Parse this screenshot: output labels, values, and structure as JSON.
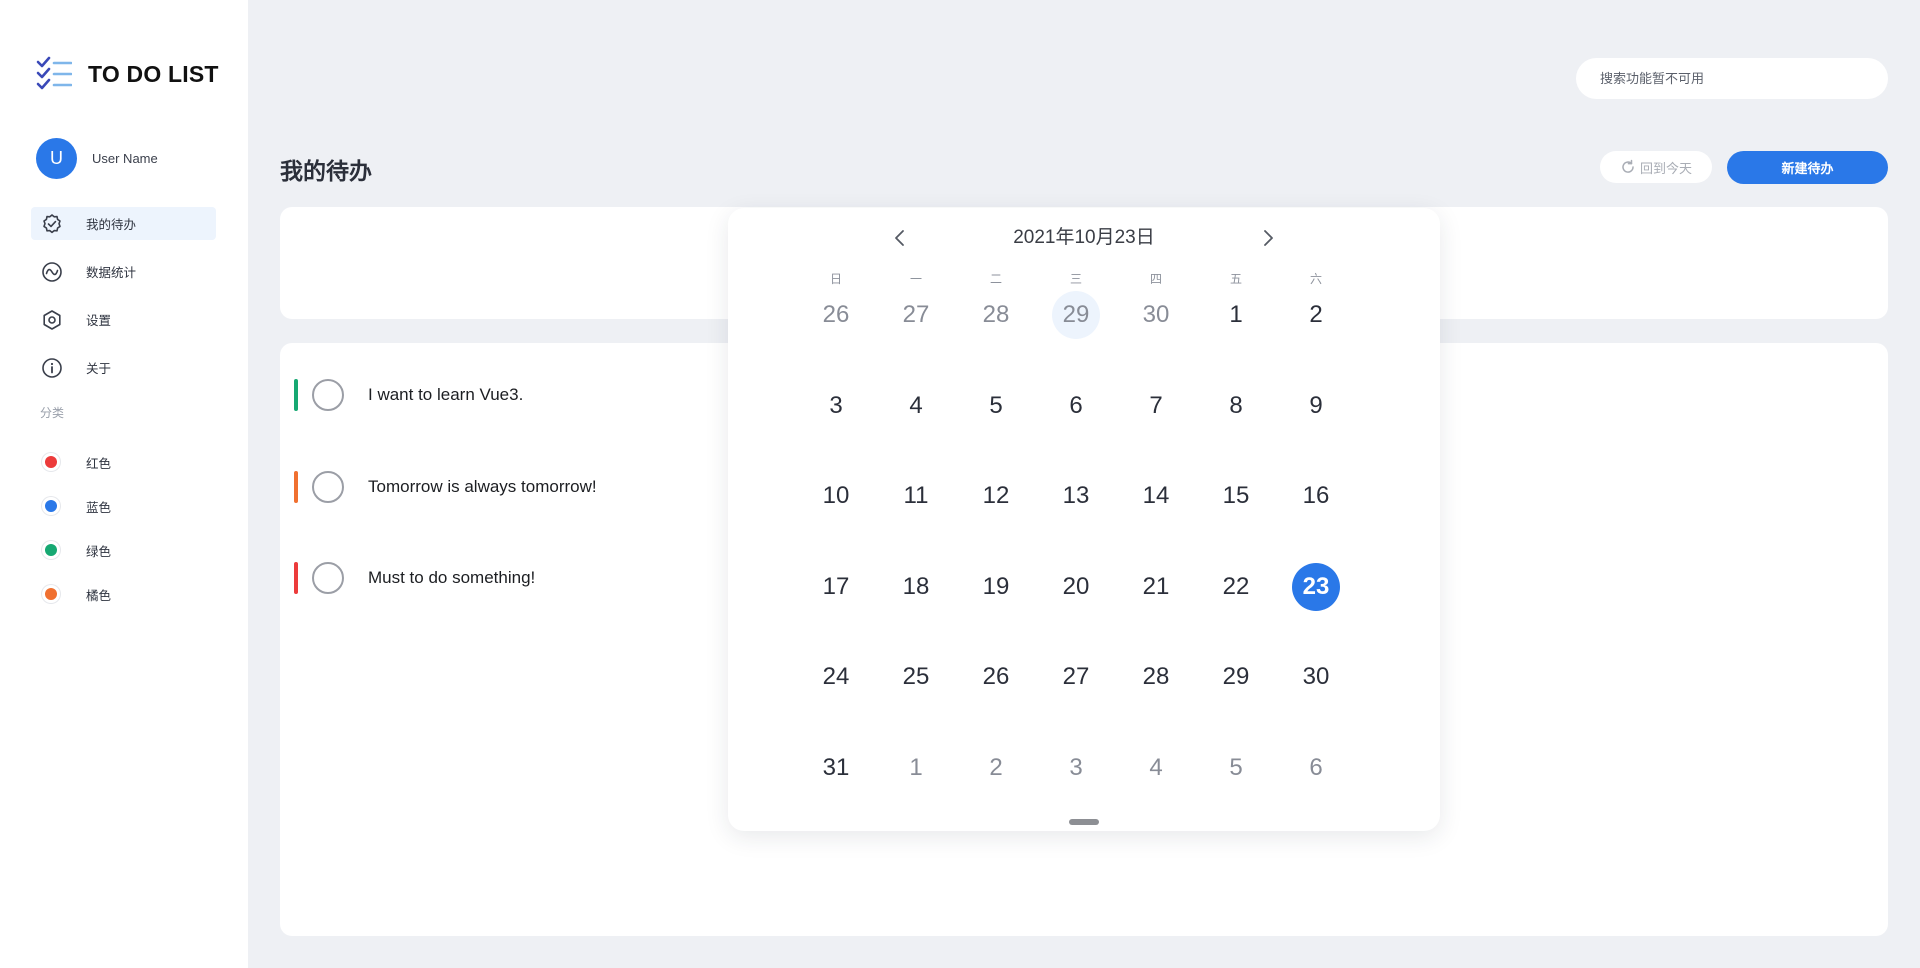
{
  "app": {
    "title": "TO DO LIST",
    "user_initial": "U",
    "user_name": "User Name"
  },
  "sidebar": {
    "nav": [
      {
        "label": "我的待办",
        "icon": "check-badge-icon"
      },
      {
        "label": "数据统计",
        "icon": "chart-wave-icon"
      },
      {
        "label": "设置",
        "icon": "settings-hex-icon"
      },
      {
        "label": "关于",
        "icon": "info-icon"
      }
    ],
    "categories_title": "分类",
    "categories": [
      {
        "label": "红色",
        "color": "#ec3b3b"
      },
      {
        "label": "蓝色",
        "color": "#2a78e8"
      },
      {
        "label": "绿色",
        "color": "#16a872"
      },
      {
        "label": "橘色",
        "color": "#f07030"
      }
    ]
  },
  "header": {
    "search_placeholder": "搜索功能暂不可用",
    "page_title": "我的待办",
    "today_label": "回到今天",
    "new_label": "新建待办"
  },
  "todos": [
    {
      "text": "I want to learn Vue3.",
      "color": "#16a872"
    },
    {
      "text": "Tomorrow is always tomorrow!",
      "color": "#f07030"
    },
    {
      "text": "Must to do something!",
      "color": "#ec3b3b"
    }
  ],
  "calendar": {
    "title": "2021年10月23日",
    "weekdays": [
      "日",
      "一",
      "二",
      "三",
      "四",
      "五",
      "六"
    ],
    "days": [
      {
        "d": "26",
        "muted": true
      },
      {
        "d": "27",
        "muted": true
      },
      {
        "d": "28",
        "muted": true
      },
      {
        "d": "29",
        "muted": true,
        "mark": true
      },
      {
        "d": "30",
        "muted": true
      },
      {
        "d": "1"
      },
      {
        "d": "2"
      },
      {
        "d": "3"
      },
      {
        "d": "4"
      },
      {
        "d": "5"
      },
      {
        "d": "6"
      },
      {
        "d": "7"
      },
      {
        "d": "8"
      },
      {
        "d": "9"
      },
      {
        "d": "10"
      },
      {
        "d": "11"
      },
      {
        "d": "12"
      },
      {
        "d": "13"
      },
      {
        "d": "14"
      },
      {
        "d": "15"
      },
      {
        "d": "16"
      },
      {
        "d": "17"
      },
      {
        "d": "18"
      },
      {
        "d": "19"
      },
      {
        "d": "20"
      },
      {
        "d": "21"
      },
      {
        "d": "22"
      },
      {
        "d": "23",
        "selected": true
      },
      {
        "d": "24"
      },
      {
        "d": "25"
      },
      {
        "d": "26"
      },
      {
        "d": "27"
      },
      {
        "d": "28"
      },
      {
        "d": "29"
      },
      {
        "d": "30"
      },
      {
        "d": "31"
      },
      {
        "d": "1",
        "muted": true
      },
      {
        "d": "2",
        "muted": true
      },
      {
        "d": "3",
        "muted": true
      },
      {
        "d": "4",
        "muted": true
      },
      {
        "d": "5",
        "muted": true
      },
      {
        "d": "6",
        "muted": true
      }
    ]
  }
}
